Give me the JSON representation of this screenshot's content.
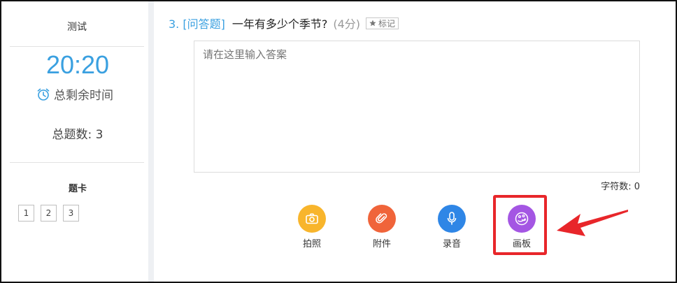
{
  "sidebar": {
    "exam_name": "测试",
    "timer": "20:20",
    "remaining_label": "总剩余时间",
    "total_questions": "总题数: 3",
    "card_title": "题卡",
    "cards": [
      "1",
      "2",
      "3"
    ]
  },
  "question": {
    "number": "3. [问答题]",
    "text": "一年有多少个季节?",
    "score": "(4分)",
    "mark_label": "标记"
  },
  "answer": {
    "placeholder": "请在这里输入答案",
    "value": "",
    "char_count": "字符数: 0"
  },
  "tools": [
    {
      "label": "拍照",
      "icon": "camera-icon",
      "color": "#f8b52c"
    },
    {
      "label": "附件",
      "icon": "paperclip-icon",
      "color": "#f0643a"
    },
    {
      "label": "录音",
      "icon": "microphone-icon",
      "color": "#2f86e6"
    },
    {
      "label": "画板",
      "icon": "palette-icon",
      "color": "#a456e3"
    }
  ],
  "colors": {
    "accent": "#3aa0e0",
    "highlight": "#e8262a",
    "arrow": "#e8262a"
  }
}
